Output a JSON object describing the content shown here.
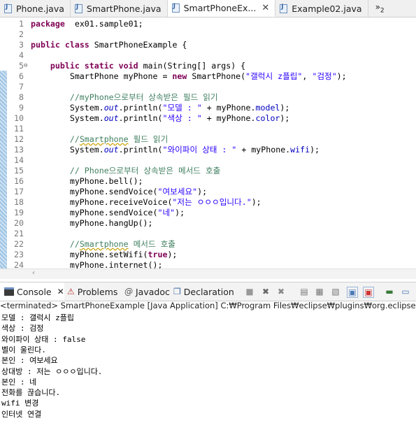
{
  "tabs": [
    {
      "label": "Phone.java",
      "active": false
    },
    {
      "label": "SmartPhone.java",
      "active": false
    },
    {
      "label": "SmartPhoneEx...",
      "active": true
    },
    {
      "label": "Example02.java",
      "active": false
    }
  ],
  "tab_overflow": {
    "symbol": "»",
    "count": "2"
  },
  "code_lines": [
    {
      "n": "1",
      "tokens": [
        [
          "kw",
          "package"
        ],
        [
          "",
          "  ex01.sample01;"
        ]
      ]
    },
    {
      "n": "2",
      "tokens": []
    },
    {
      "n": "3",
      "tokens": [
        [
          "kw",
          "public"
        ],
        [
          "",
          " "
        ],
        [
          "kw",
          "class"
        ],
        [
          "",
          " SmartPhoneExample {"
        ]
      ]
    },
    {
      "n": "4",
      "tokens": []
    },
    {
      "n": "5",
      "fold": "⊖",
      "tokens": [
        [
          "",
          "    "
        ],
        [
          "kw",
          "public"
        ],
        [
          "",
          " "
        ],
        [
          "kw",
          "static"
        ],
        [
          "",
          " "
        ],
        [
          "kw",
          "void"
        ],
        [
          "",
          " main(String[] args) {"
        ]
      ]
    },
    {
      "n": "6",
      "tokens": [
        [
          "",
          "        SmartPhone myPhone = "
        ],
        [
          "kw",
          "new"
        ],
        [
          "",
          " SmartPhone("
        ],
        [
          "str",
          "\"갤럭시 z플립\""
        ],
        [
          "",
          ", "
        ],
        [
          "str",
          "\"검정\""
        ],
        [
          "",
          ");"
        ]
      ]
    },
    {
      "n": "7",
      "tokens": []
    },
    {
      "n": "8",
      "tokens": [
        [
          "",
          "        "
        ],
        [
          "cm",
          "//myPhone으로부터 상속받은 필드 읽기"
        ]
      ]
    },
    {
      "n": "9",
      "tokens": [
        [
          "",
          "        System."
        ],
        [
          "sfld",
          "out"
        ],
        [
          "",
          ".println("
        ],
        [
          "str",
          "\"모델 : \""
        ],
        [
          "",
          " + myPhone."
        ],
        [
          "fld",
          "model"
        ],
        [
          "",
          ");"
        ]
      ]
    },
    {
      "n": "10",
      "tokens": [
        [
          "",
          "        System."
        ],
        [
          "sfld",
          "out"
        ],
        [
          "",
          ".println("
        ],
        [
          "str",
          "\"색상 : \""
        ],
        [
          "",
          " + myPhone."
        ],
        [
          "fld",
          "color"
        ],
        [
          "",
          ");"
        ]
      ]
    },
    {
      "n": "11",
      "tokens": []
    },
    {
      "n": "12",
      "tokens": [
        [
          "",
          "        "
        ],
        [
          "cm",
          "//Smartphone 필드 읽기"
        ]
      ]
    },
    {
      "n": "13",
      "tokens": [
        [
          "",
          "        System."
        ],
        [
          "sfld",
          "out"
        ],
        [
          "",
          ".println("
        ],
        [
          "str",
          "\"와이파이 상태 : \""
        ],
        [
          "",
          " + myPhone."
        ],
        [
          "fld",
          "wifi"
        ],
        [
          "",
          ");"
        ]
      ]
    },
    {
      "n": "14",
      "tokens": []
    },
    {
      "n": "15",
      "tokens": [
        [
          "",
          "        "
        ],
        [
          "cm",
          "// Phone으로부터 상속받은 메서드 호출"
        ]
      ]
    },
    {
      "n": "16",
      "tokens": [
        [
          "",
          "        myPhone.bell();"
        ]
      ]
    },
    {
      "n": "17",
      "tokens": [
        [
          "",
          "        myPhone.sendVoice("
        ],
        [
          "str",
          "\"여보세요\""
        ],
        [
          "",
          ");"
        ]
      ]
    },
    {
      "n": "18",
      "tokens": [
        [
          "",
          "        myPhone.receiveVoice("
        ],
        [
          "str",
          "\"저는 ㅇㅇㅇ입니다.\""
        ],
        [
          "",
          ");"
        ]
      ]
    },
    {
      "n": "19",
      "tokens": [
        [
          "",
          "        myPhone.sendVoice("
        ],
        [
          "str",
          "\"네\""
        ],
        [
          "",
          ");"
        ]
      ]
    },
    {
      "n": "20",
      "tokens": [
        [
          "",
          "        myPhone.hangUp();"
        ]
      ]
    },
    {
      "n": "21",
      "tokens": []
    },
    {
      "n": "22",
      "tokens": [
        [
          "",
          "        "
        ],
        [
          "cm",
          "//Smartphone 메서드 호출"
        ]
      ]
    },
    {
      "n": "23",
      "tokens": [
        [
          "",
          "        myPhone.setWifi("
        ],
        [
          "kw",
          "true"
        ],
        [
          "",
          ");"
        ]
      ]
    },
    {
      "n": "24",
      "tokens": [
        [
          "",
          "        myPhone.internet();"
        ]
      ]
    }
  ],
  "panel_tabs": {
    "console": "Console",
    "problems": "Problems",
    "javadoc": "Javadoc",
    "declaration": "Declaration"
  },
  "console_header": "<terminated> SmartPhoneExample [Java Application] C:₩Program Files₩eclipse₩plugins₩org.eclipse.justj.openjdk",
  "console_output": [
    "모델 : 갤럭시 z플립",
    "색상 : 검정",
    "와이파이 상태 : false",
    "벨이 울린다.",
    "본인 : 여보세요",
    "상대방 : 저는 ㅇㅇㅇ입니다.",
    "본인 : 네",
    "전화를 끊습니다.",
    "wifi 변경",
    "인터넷 연결"
  ]
}
